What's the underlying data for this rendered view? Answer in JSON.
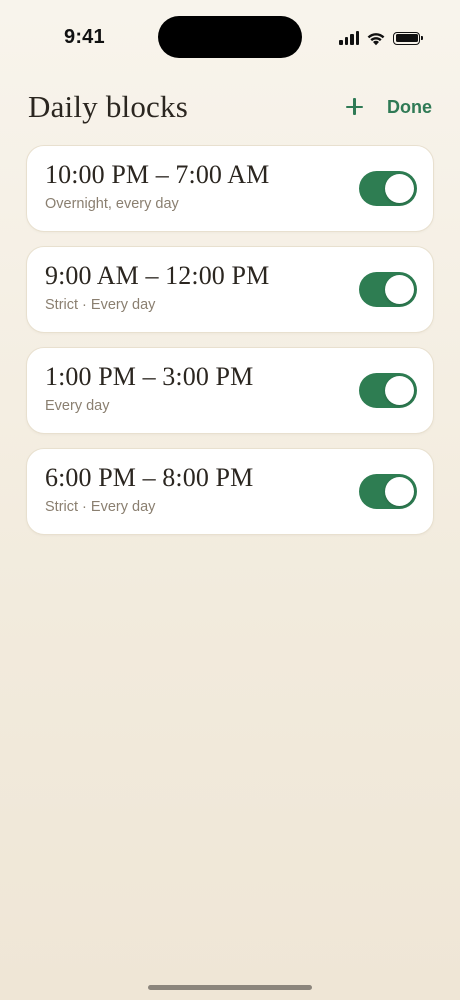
{
  "status_bar": {
    "time": "9:41",
    "icons": [
      "signal-icon",
      "wifi-icon",
      "battery-icon"
    ]
  },
  "header": {
    "title": "Daily blocks",
    "add_icon": "plus-icon",
    "done_label": "Done"
  },
  "colors": {
    "accent": "#2f7a55",
    "toggle_on": "#2e7d52",
    "card_bg": "#ffffff",
    "page_bg": "#f5efe4",
    "subtitle": "#8a7f70"
  },
  "blocks": [
    {
      "time_range": "10:00 PM – 7:00 AM",
      "subtitle": "Overnight, every day",
      "enabled": true
    },
    {
      "time_range": "9:00 AM – 12:00 PM",
      "subtitle": "Strict · Every day",
      "enabled": true
    },
    {
      "time_range": "1:00 PM – 3:00 PM",
      "subtitle": "Every day",
      "enabled": true
    },
    {
      "time_range": "6:00 PM – 8:00 PM",
      "subtitle": "Strict · Every day",
      "enabled": true
    }
  ]
}
